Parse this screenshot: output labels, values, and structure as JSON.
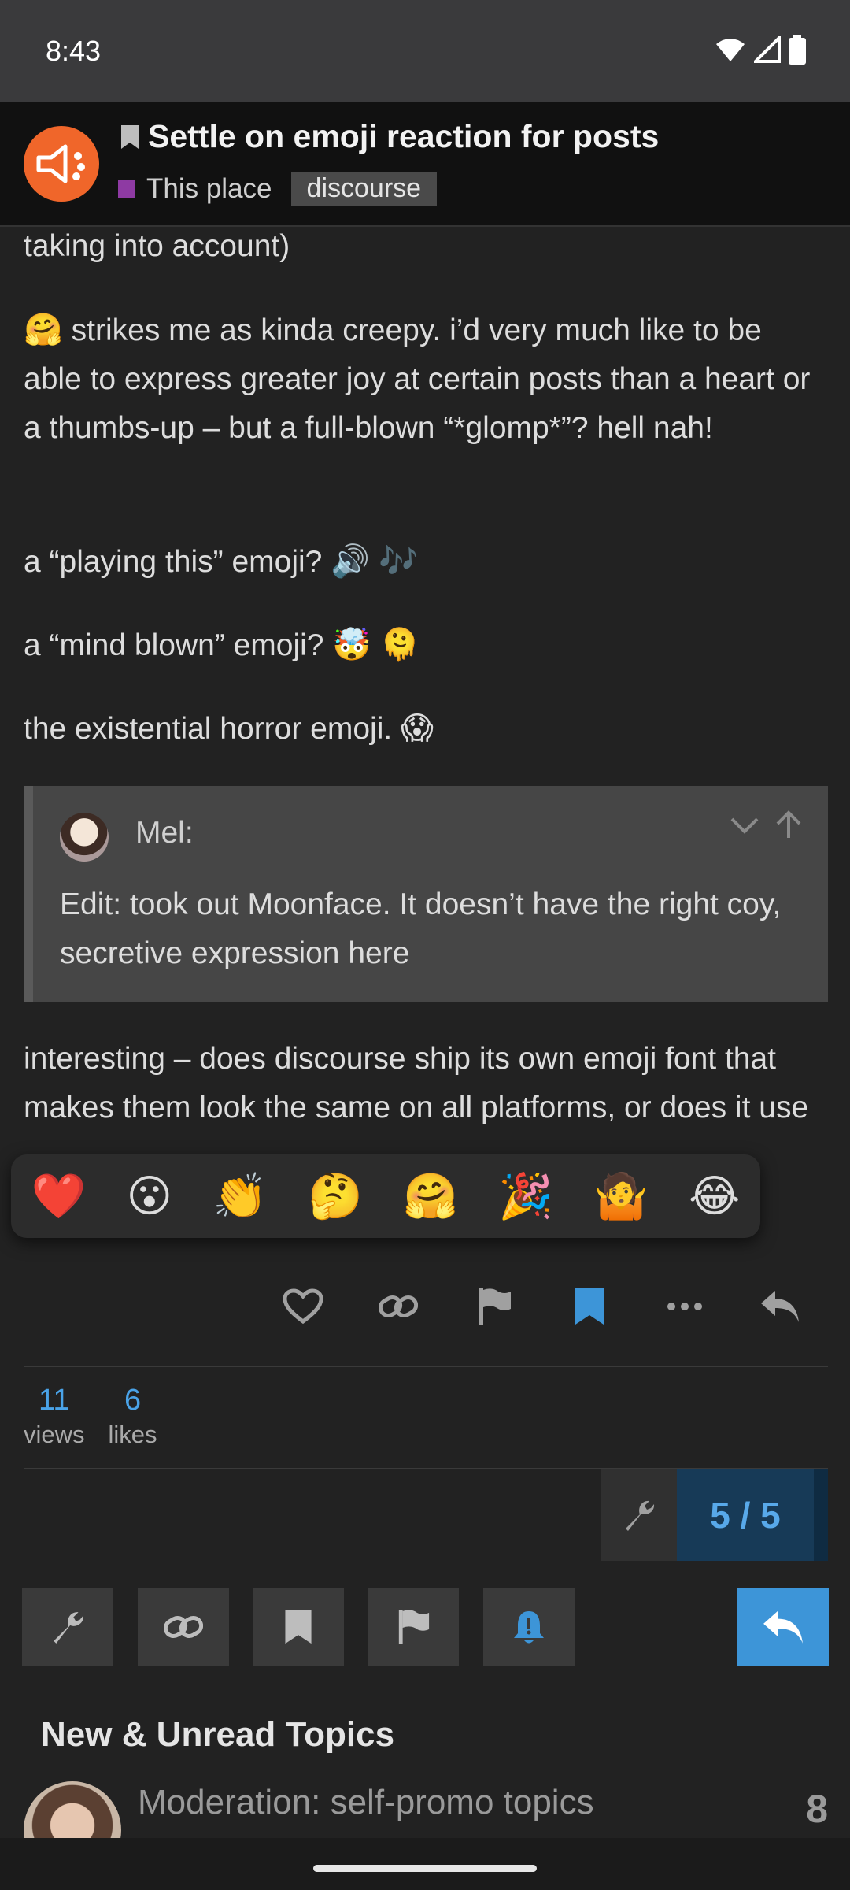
{
  "status_bar": {
    "time": "8:43",
    "icons": [
      "wifi-icon",
      "signal-icon",
      "battery-icon"
    ]
  },
  "topic": {
    "title": "Settle on emoji reaction for posts",
    "category": "This place",
    "category_color": "#8e3aa3",
    "tag": "discourse",
    "bookmark_icon": "bookmark-icon"
  },
  "post": {
    "p0": "taking into account)",
    "p1_emoji": "🤗",
    "p1": " strikes me as kinda creepy. i’d very much like to be able to express greater joy at certain posts than a heart or a thumbs-up – but a full-blown “*glomp*”? hell nah!",
    "p2": "a “playing this” emoji?",
    "p2_emoji": "🔊 🎶",
    "p3": "a “mind blown” emoji?",
    "p3_emoji": "🤯 🫠",
    "p4": "the existential horror emoji.",
    "p4_emoji": "😱",
    "quote": {
      "author": "Mel:",
      "text": "Edit: took out Moonface. It doesn’t have the right coy, secretive expression here"
    },
    "p5": "interesting – does discourse ship its own emoji font that makes them look the same on all platforms, or does it use the system default ones, which can"
  },
  "reactions": [
    "❤️",
    "😮",
    "👏",
    "🤔",
    "🤗",
    "🎉",
    "🤷",
    "😂"
  ],
  "post_actions": [
    "like",
    "copy-link",
    "flag",
    "bookmark",
    "more",
    "reply"
  ],
  "stats": {
    "views_count": "11",
    "views_label": "views",
    "likes_count": "6",
    "likes_label": "likes"
  },
  "progress": {
    "text": "5 / 5"
  },
  "accent_color": "#3d95d8",
  "new_unread": {
    "heading": "New & Unread Topics",
    "topic_title": "Moderation: self-promo topics",
    "topic_count": "8"
  }
}
